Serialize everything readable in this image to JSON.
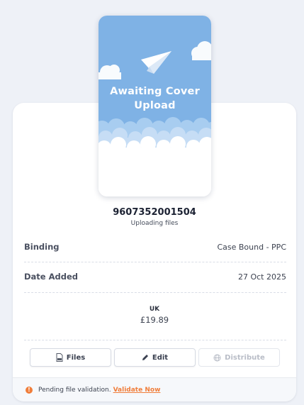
{
  "cover": {
    "line1": "Awaiting Cover",
    "line2": "Upload"
  },
  "book": {
    "isbn": "9607352001504",
    "status": "Uploading files"
  },
  "details": [
    {
      "label": "Binding",
      "value": "Case Bound - PPC"
    },
    {
      "label": "Date Added",
      "value": "27 Oct 2025"
    }
  ],
  "market": {
    "code": "UK",
    "price": "£19.89"
  },
  "actions": {
    "files": "Files",
    "edit": "Edit",
    "distribute": "Distribute"
  },
  "footer": {
    "message": "Pending file validation.",
    "link": "Validate Now",
    "warning_icon": "!"
  },
  "colors": {
    "sky": "#7fb2e5",
    "accent": "#f07d3a"
  }
}
